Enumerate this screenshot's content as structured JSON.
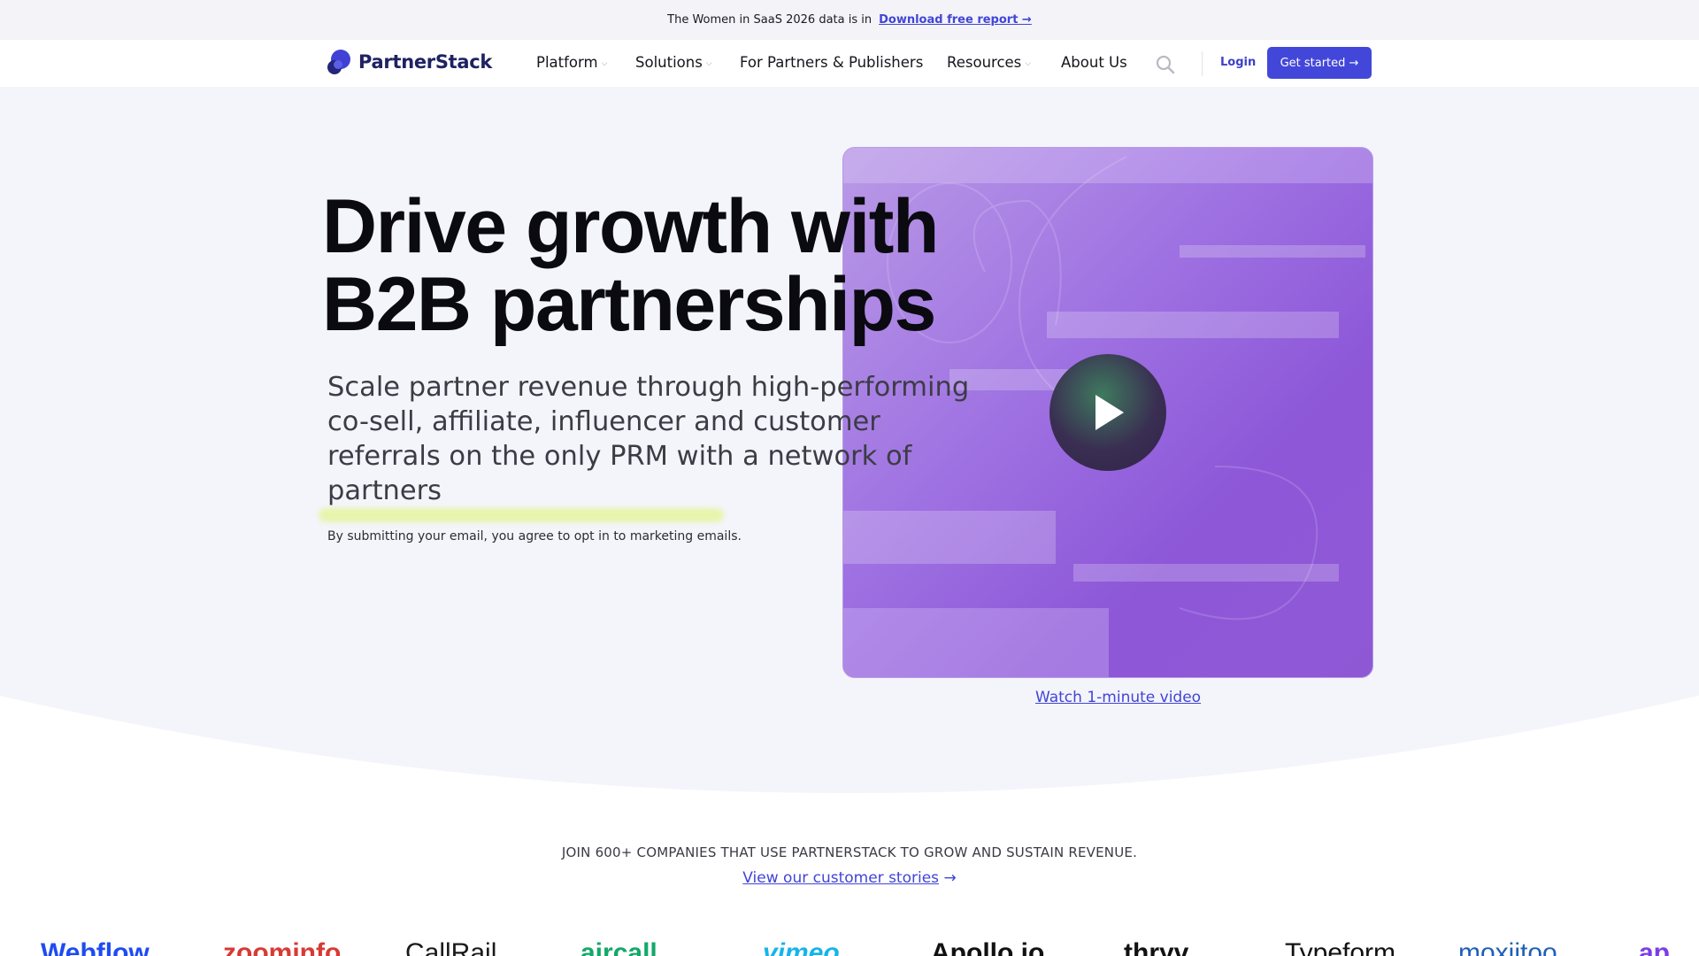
{
  "announcement": {
    "text": "The Women in SaaS 2026 data is in",
    "link_label": "Download free report →"
  },
  "brand": {
    "name": "PartnerStack"
  },
  "nav": {
    "items": [
      {
        "label": "Platform",
        "dropdown": true
      },
      {
        "label": "Solutions",
        "dropdown": true
      },
      {
        "label": "For Partners & Publishers",
        "dropdown": false
      },
      {
        "label": "Resources",
        "dropdown": true
      },
      {
        "label": "About Us",
        "dropdown": false
      }
    ],
    "login_label": "Login",
    "cta_label": "Get started →"
  },
  "hero": {
    "headline_line1": "Drive growth with",
    "headline_line2": "B2B partnerships",
    "subhead": "Scale partner revenue through high-performing co-sell, affiliate, influencer and customer referrals on the only PRM with a network of partners",
    "consent": "By submitting your email, you agree to opt in to marketing emails.",
    "video_link": "Watch 1-minute video"
  },
  "social_proof": {
    "join_text": "JOIN 600+ COMPANIES THAT USE PARTNERSTACK TO GROW AND SUSTAIN REVENUE.",
    "stories_link": "View our customer stories",
    "stories_arrow": "→",
    "logos": [
      "Webflow",
      "zoominfo",
      "CallRail",
      "aircall",
      "vimeo",
      "Apollo.io",
      "thryv",
      "Typeform",
      "moxiitoo",
      "ap"
    ]
  },
  "colors": {
    "accent": "#4347d9",
    "hero_bg": "#f4f4fb",
    "video_purple": "#8d57d8",
    "highlight": "#e6f5a3"
  }
}
